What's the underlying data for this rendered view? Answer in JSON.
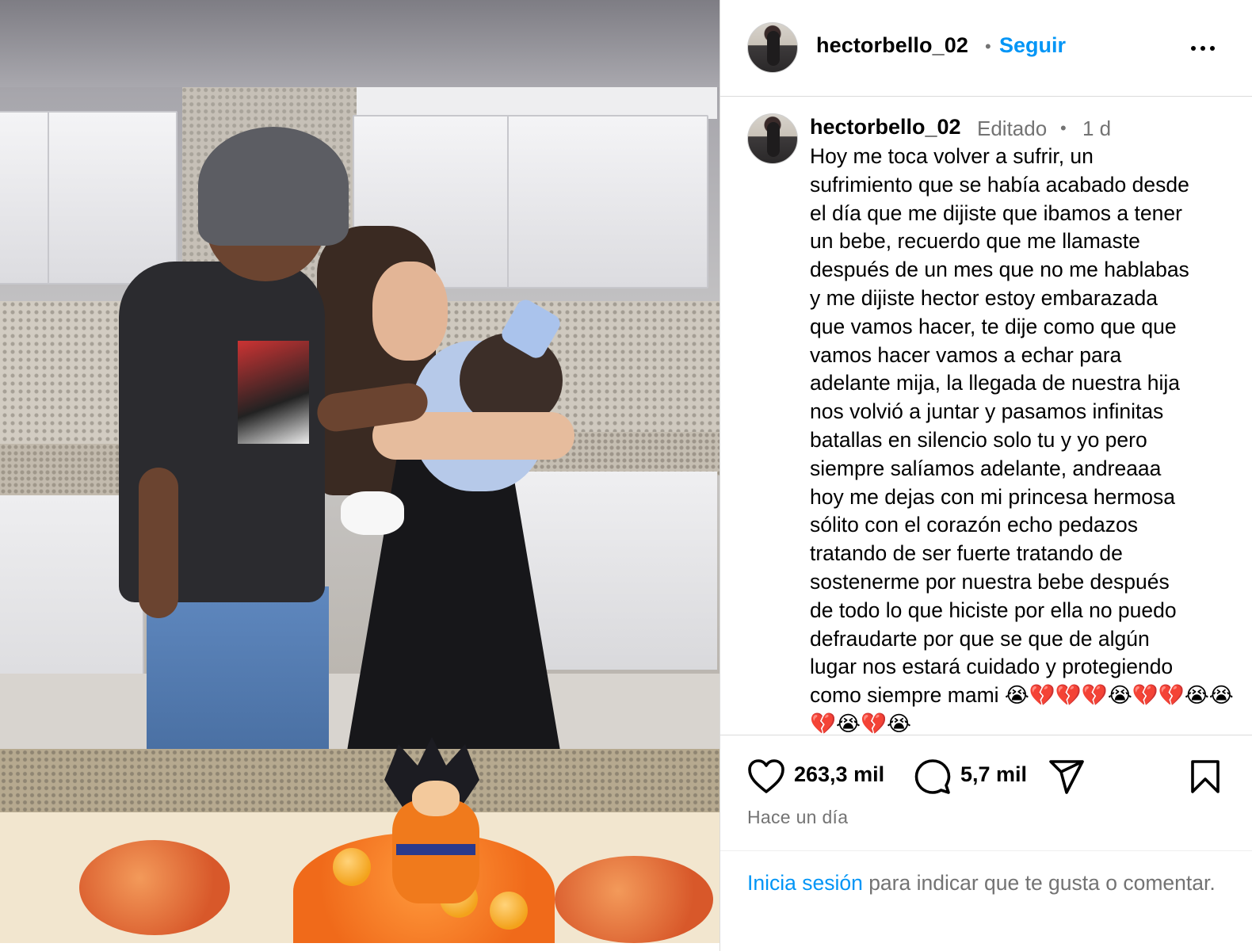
{
  "post": {
    "username": "hectorbello_02",
    "follow_label": "Seguir",
    "separator": "•",
    "caption_meta": {
      "edited": "Editado",
      "separator": "•",
      "time": "1 d"
    },
    "caption_text": "Hoy me toca volver a sufrir, un\nsufrimiento que se había acabado desde\nel día que me dijiste que ibamos a tener\nun bebe, recuerdo que me llamaste\ndespués de un mes que no me hablabas\ny me dijiste hector estoy embarazada\nque vamos hacer, te dije como que que\nvamos hacer vamos a echar para\nadelante mija, la llegada de nuestra hija\nnos volvió a juntar y pasamos infinitas\nbatallas en silencio solo tu y yo pero\nsiempre salíamos adelante, andreaaa\nhoy me dejas con mi princesa hermosa\nsólito con el corazón echo pedazos\ntratando de ser fuerte tratando de\nsostenerme por nuestra bebe después\nde todo lo que hiciste por ella no puedo\ndefraudarte por que se que de algún\nlugar nos estará cuidado y protegiendo\ncomo siempre mami 😭💔💔💔😭💔💔😭😭\n💔😭💔😭",
    "likes": "263,3 mil",
    "comments": "5,7 mil",
    "timestamp": "Hace un día"
  },
  "login_prompt": {
    "link": "Inicia sesión",
    "text": " para indicar que te gusta o comentar."
  },
  "icons": {
    "more": "more-options-icon",
    "like": "heart-icon",
    "comment": "comment-bubble-icon",
    "share": "paper-plane-icon",
    "save": "bookmark-icon"
  },
  "colors": {
    "link_blue": "#0095f6",
    "secondary_text": "#737373",
    "divider": "#dbdbdb"
  }
}
